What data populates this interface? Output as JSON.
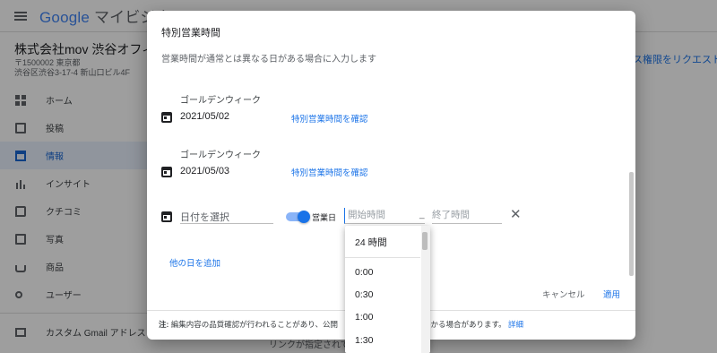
{
  "app": {
    "logo_google": "Google",
    "logo_rest": " マイビジネス"
  },
  "business": {
    "name": "株式会社mov 渋谷オフィス",
    "postal": "〒1500002 東京都",
    "address": "渋谷区渋谷3-17-4 新山口ビル4F"
  },
  "header": {
    "request_link": "ス権限をリクエスト"
  },
  "sidebar": {
    "items": [
      {
        "label": "ホーム",
        "icon": "dashboard-icon"
      },
      {
        "label": "投稿",
        "icon": "post-icon"
      },
      {
        "label": "情報",
        "icon": "store-icon",
        "active": true
      },
      {
        "label": "インサイト",
        "icon": "insights-icon"
      },
      {
        "label": "クチコミ",
        "icon": "reviews-icon"
      },
      {
        "label": "写真",
        "icon": "photo-icon"
      },
      {
        "label": "商品",
        "icon": "products-icon"
      },
      {
        "label": "ユーザー",
        "icon": "add-user-icon"
      }
    ],
    "gmail_label": "カスタム Gmail アドレス"
  },
  "background": {
    "bottom_text": "リンクが指定されていま"
  },
  "dialog": {
    "title": "特別営業時間",
    "subtitle": "営業時間が通常とは異なる日がある場合に入力します",
    "entries": [
      {
        "title": "ゴールデンウィーク",
        "date": "2021/05/02",
        "link": "特別営業時間を確認"
      },
      {
        "title": "ゴールデンウィーク",
        "date": "2021/05/03",
        "link": "特別営業時間を確認"
      }
    ],
    "new_row": {
      "date_placeholder": "日付を選択",
      "toggle_label": "営業日",
      "start_placeholder": "開始時間",
      "dash": "_",
      "end_placeholder": "終了時間"
    },
    "add_day": "他の日を追加",
    "cancel": "キャンセル",
    "apply": "適用",
    "footer": {
      "prefix": "注:",
      "text": " 編集内容の品質確認が行われることがあり、公開",
      "text2": "かかる場合があります。",
      "details": "詳細"
    }
  },
  "dropdown": {
    "options": [
      "24 時間",
      "0:00",
      "0:30",
      "1:00",
      "1:30"
    ]
  }
}
